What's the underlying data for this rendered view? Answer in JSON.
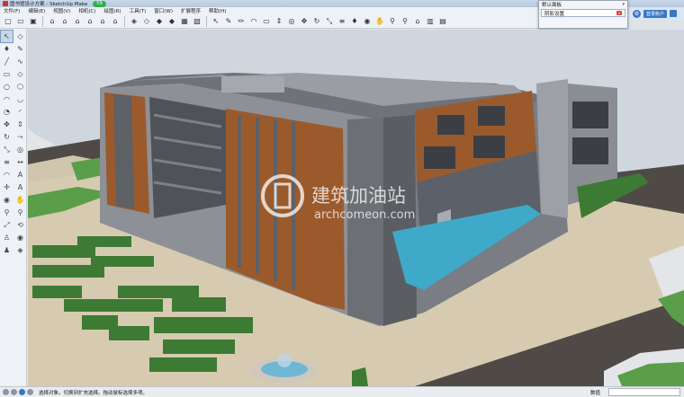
{
  "window": {
    "title": "图书馆设计方案 - SketchUp Make",
    "badge": "59"
  },
  "menu": [
    "文件(F)",
    "编辑(E)",
    "视图(V)",
    "相机(C)",
    "绘图(R)",
    "工具(T)",
    "窗口(W)",
    "扩展程序",
    "帮助(H)"
  ],
  "tray": {
    "title": "默认面板",
    "item": "阴影设置",
    "close": "x"
  },
  "signin": {
    "button": "登录账户"
  },
  "status": {
    "hint": "选择对象。切换到扩充选择。拖动鼠标选择多项。",
    "measure_label": "数值",
    "measure_value": ""
  },
  "watermark": {
    "text": "建筑加油站",
    "sub": "archcomeon.com"
  },
  "colors": {
    "sky": "#cfd6de",
    "ground": "#4f4a45",
    "plaza": "#d6cbb0",
    "lawn": "#5a9e4a",
    "pool": "#3fa9c9",
    "wood": "#9b5a2c",
    "concrete": "#8d9096",
    "hedge": "#3d7a33"
  }
}
